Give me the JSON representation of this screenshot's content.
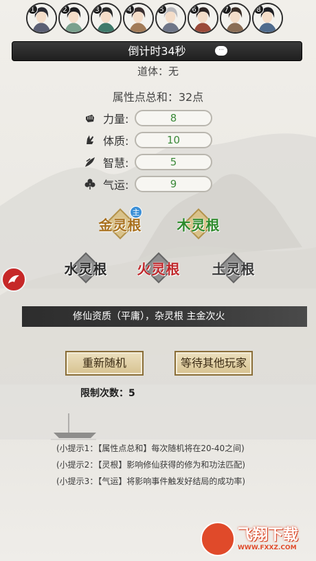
{
  "players": [
    {
      "num": "1",
      "ring": "#2f2f2f",
      "hair": "#2b2b33",
      "robe": "#5b5f74"
    },
    {
      "num": "2",
      "ring": "#2f2f2f",
      "hair": "#1d1d20",
      "robe": "#7aa08d"
    },
    {
      "num": "3",
      "ring": "#2f2f2f",
      "hair": "#2a2a2a",
      "robe": "#3f7a6b"
    },
    {
      "num": "4",
      "ring": "#2f2f2f",
      "hair": "#3a3030",
      "robe": "#a27b58"
    },
    {
      "num": "5",
      "ring": "#2f2f2f",
      "hair": "#b9b9bd",
      "robe": "#6f7688"
    },
    {
      "num": "6",
      "ring": "#2f2f2f",
      "hair": "#2e2524",
      "robe": "#9b4a3a"
    },
    {
      "num": "7",
      "ring": "#2f2f2f",
      "hair": "#3b2e27",
      "robe": "#8a6d55"
    },
    {
      "num": "8",
      "ring": "#2f2f2f",
      "hair": "#1f1f24",
      "robe": "#4f6b8d"
    }
  ],
  "timer": {
    "text": "倒计时34秒",
    "chat_icon": "chat-bubble-icon",
    "chat_glyph": "···"
  },
  "body_type": "道体：无",
  "attr_total": "属性点总和：32点",
  "stats": [
    {
      "label": "力量:",
      "value": "8",
      "icon": "fist-icon"
    },
    {
      "label": "体质:",
      "value": "10",
      "icon": "hand-icon"
    },
    {
      "label": "智慧:",
      "value": "5",
      "icon": "leaf-icon"
    },
    {
      "label": "气运:",
      "value": "9",
      "icon": "clover-icon"
    }
  ],
  "roots": {
    "jin": {
      "label": "金灵根",
      "badge": "主",
      "active": true
    },
    "mu": {
      "label": "木灵根",
      "active": true
    },
    "shui": {
      "label": "水灵根",
      "active": false
    },
    "huo": {
      "label": "火灵根",
      "active": false
    },
    "tu": {
      "label": "土灵根",
      "active": false
    }
  },
  "quality": "修仙资质（平庸），杂灵根 主金次火",
  "buttons": {
    "reroll": "重新随机",
    "wait": "等待其他玩家"
  },
  "limit": "限制次数：5",
  "tips": [
    "(小提示1：【属性点总和】每次随机将在20-40之间)",
    "(小提示2：【灵根】影响修仙获得的修为和功法匹配)",
    "(小提示3：【气运】将影响事件触发好结局的成功率)"
  ],
  "watermark": {
    "title": "飞翔下载",
    "url": "WWW.FXXZ.COM"
  },
  "colors": {
    "stat_value": "#3c8a3a",
    "accent_red": "#c0272b",
    "accent_green": "#2e8a2c",
    "accent_gold": "#a8701c"
  }
}
